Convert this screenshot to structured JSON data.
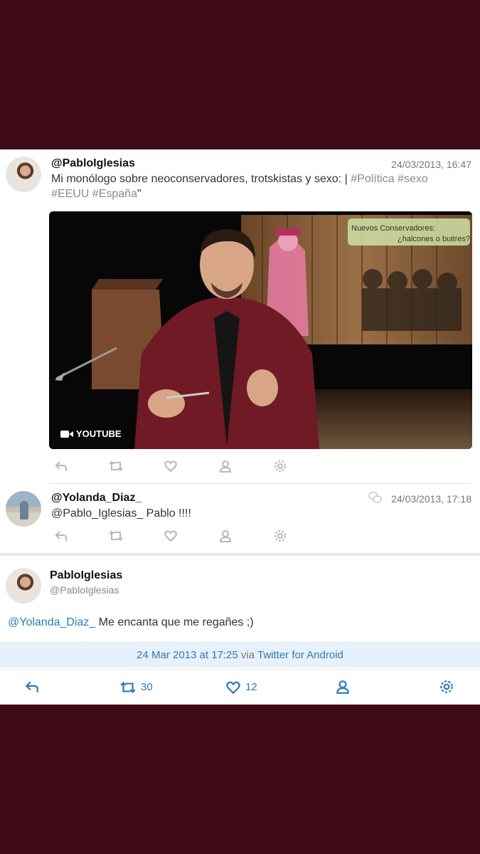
{
  "tweet1": {
    "handle": "@PabloIglesias",
    "date": "24/03/2013, 16:47",
    "text_prefix": "Mi monólogo sobre neoconservadores, trotskistas y sexo: | ",
    "tags_line1": "#Política #sexo",
    "tags_line2": "#EEUU #España",
    "text_suffix": "\"",
    "media": {
      "badge": "YOUTUBE",
      "caption_line1": "Nuevos Conservadores:",
      "caption_line2": "¿halcones o buitres?"
    }
  },
  "tweet2": {
    "handle": "@Yolanda_Diaz_",
    "date": "24/03/2013, 17:18",
    "mention": "@Pablo_Iglesias_",
    "text": " Pablo !!!!"
  },
  "main_tweet": {
    "display_name": "PabloIglesias",
    "handle": "@PabloIglesias",
    "mention": "@Yolanda_Diaz_",
    "text": " Me encanta que me regañes ;)",
    "timestamp": "24 Mar 2013 at 17:25",
    "via_word": " via ",
    "client": "Twitter for Android",
    "retweets": "30",
    "likes": "12"
  },
  "colors": {
    "background": "#3f0a18",
    "link": "#2b7bb9",
    "icon_gray": "#b8b8b8"
  }
}
